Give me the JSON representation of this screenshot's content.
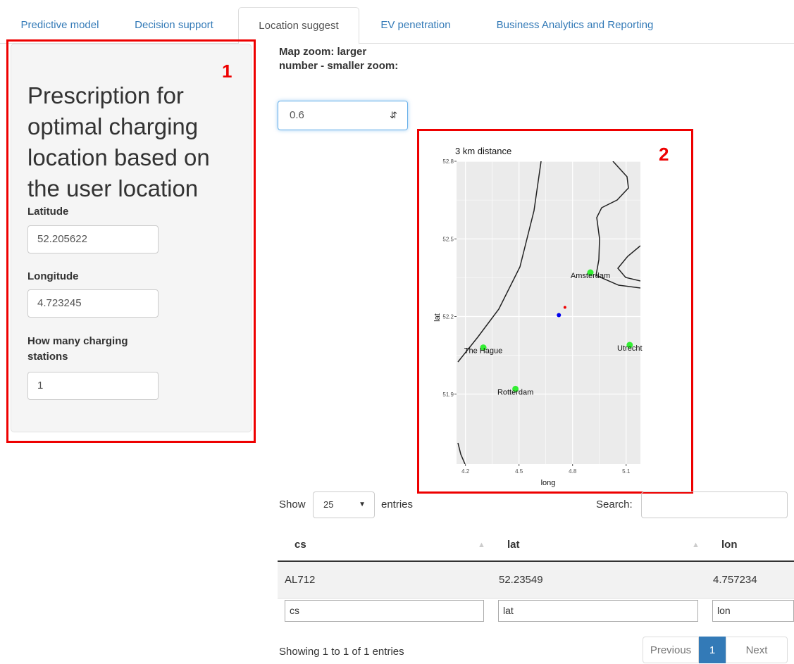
{
  "tabs": [
    {
      "label": "Predictive model"
    },
    {
      "label": "Decision support"
    },
    {
      "label": "Location suggest"
    },
    {
      "label": "EV penetration"
    },
    {
      "label": "Business Analytics and Reporting"
    }
  ],
  "left_panel": {
    "annotation": "1",
    "title": "Prescription for optimal charging location based on the user location",
    "latitude_label": "Latitude",
    "latitude_value": "52.205622",
    "longitude_label": "Longitude",
    "longitude_value": "4.723245",
    "stations_label": "How many charging stations",
    "stations_value": "1"
  },
  "zoom": {
    "label": "Map zoom: larger number - smaller zoom:",
    "value": "0.6",
    "spinner_icon": "up-down-arrows-icon"
  },
  "plot": {
    "annotation": "2",
    "title": "3  km distance",
    "xlabel": "long",
    "ylabel": "lat",
    "x_ticks": [
      "4.2",
      "4.5",
      "4.8",
      "5.1"
    ],
    "y_ticks": [
      "52.8",
      "52.5",
      "52.2",
      "51.9"
    ],
    "colors": {
      "panel": "#ebebeb",
      "grid": "#ffffff",
      "city": "#33ee33",
      "user": "#0000ee",
      "station": "#ee0000",
      "border": "#222222"
    }
  },
  "chart_data": {
    "type": "scatter",
    "title": "3  km distance",
    "xlabel": "long",
    "ylabel": "lat",
    "xlim": [
      4.15,
      5.18
    ],
    "ylim": [
      51.63,
      52.8
    ],
    "series": [
      {
        "points": [
          {
            "x": 4.9,
            "y": 52.37,
            "label": "Amsterdam"
          },
          {
            "x": 4.3,
            "y": 52.08,
            "label": "The Hague"
          },
          {
            "x": 5.12,
            "y": 52.09,
            "label": "Utrecht"
          },
          {
            "x": 4.48,
            "y": 51.92,
            "label": "Rotterdam"
          }
        ]
      },
      {
        "points": [
          {
            "x": 4.723245,
            "y": 52.205622
          }
        ]
      },
      {
        "points": [
          {
            "x": 4.757234,
            "y": 52.23549
          }
        ]
      }
    ]
  },
  "table": {
    "show_label": "Show",
    "entries_value": "25",
    "entries_label": "entries",
    "search_label": "Search:",
    "columns": [
      "cs",
      "lat",
      "lon"
    ],
    "rows": [
      [
        "AL712",
        "52.23549",
        "4.757234"
      ]
    ],
    "filters": [
      "cs",
      "lat",
      "lon"
    ],
    "info": "Showing 1 to 1 of 1 entries",
    "pagination": {
      "previous": "Previous",
      "current": "1",
      "next": "Next"
    }
  }
}
